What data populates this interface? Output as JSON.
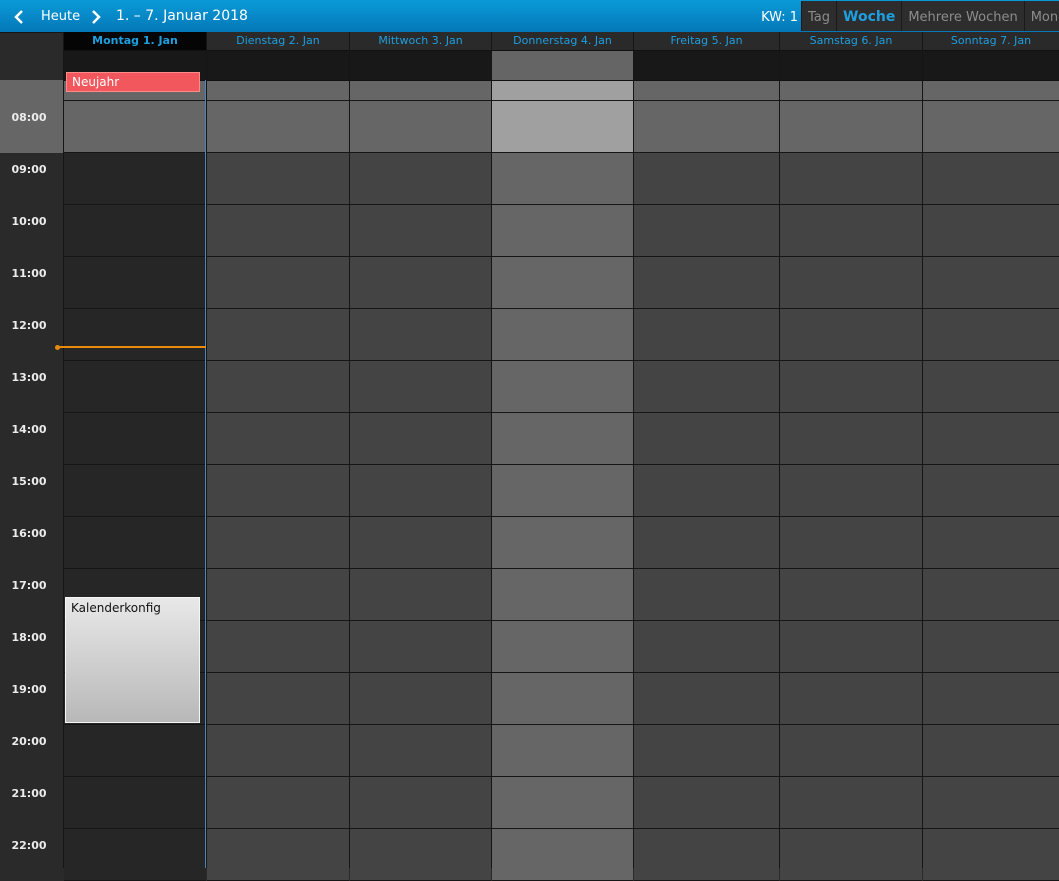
{
  "toolbar": {
    "prev_icon": "chevron-left",
    "today_label": "Heute",
    "next_icon": "chevron-right",
    "range_title": "1. – 7. Januar 2018",
    "week_number": "KW: 1",
    "views": [
      {
        "label": "Tag",
        "active": false
      },
      {
        "label": "Woche",
        "active": true
      },
      {
        "label": "Mehrere Wochen",
        "active": false
      },
      {
        "label": "Monat",
        "active": false
      }
    ]
  },
  "days": [
    {
      "label": "Montag 1. Jan",
      "today": true
    },
    {
      "label": "Dienstag 2. Jan",
      "today": false
    },
    {
      "label": "Mittwoch 3. Jan",
      "today": false
    },
    {
      "label": "Donnerstag 4. Jan",
      "today": false
    },
    {
      "label": "Freitag 5. Jan",
      "today": false
    },
    {
      "label": "Samstag 6. Jan",
      "today": false
    },
    {
      "label": "Sonntag 7. Jan",
      "today": false
    }
  ],
  "hours": [
    "08:00",
    "09:00",
    "10:00",
    "11:00",
    "12:00",
    "13:00",
    "14:00",
    "15:00",
    "16:00",
    "17:00",
    "18:00",
    "19:00",
    "20:00",
    "21:00",
    "22:00"
  ],
  "events": {
    "allday_title": "Neujahr",
    "timed_title": "Kalenderkonfig"
  },
  "colors": {
    "accent": "#1e9fe0",
    "toolbar": "#0a8ccc",
    "allday_event": "#f2575d",
    "now_indicator": "#e88b0c"
  }
}
